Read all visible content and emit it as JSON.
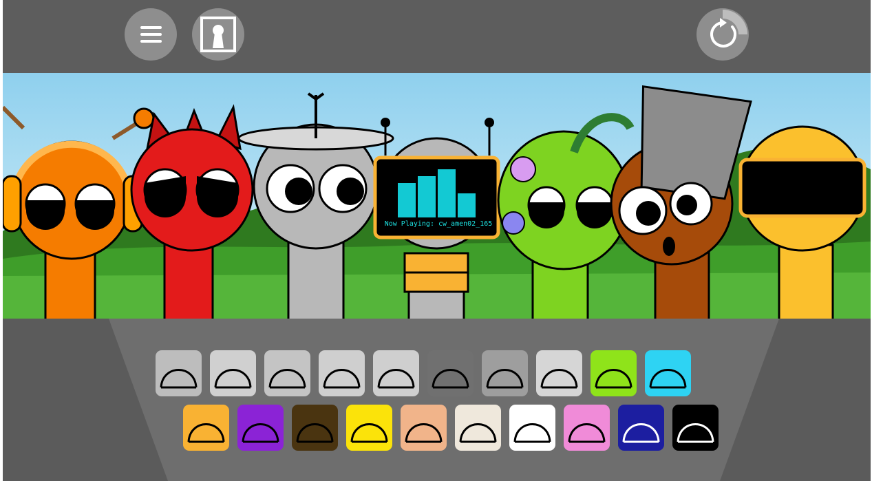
{
  "toolbar": {
    "menu_icon": "hamburger-menu-icon",
    "frame_icon": "keyhole-frame-icon",
    "reset_icon": "refresh-icon"
  },
  "stage": {
    "now_playing": "Now Playing: cw_amen02_165",
    "characters": [
      {
        "name": "orange-headphones",
        "color": "#f57c00"
      },
      {
        "name": "red-horns",
        "color": "#e31b1b"
      },
      {
        "name": "gray-satellite",
        "color": "#b8b8b8"
      },
      {
        "name": "tv-head",
        "color": "#f9b233"
      },
      {
        "name": "green-leaf",
        "color": "#7ed321"
      },
      {
        "name": "brown-bucket",
        "color": "#a64b0a"
      },
      {
        "name": "yellow-visor",
        "color": "#fbc02d"
      }
    ]
  },
  "tray": {
    "row1": [
      {
        "name": "headphones-costume",
        "bg": "#bdbdbd",
        "state": "used"
      },
      {
        "name": "spiky-hair-costume",
        "bg": "#d0d0d0",
        "state": "used"
      },
      {
        "name": "satellite-costume",
        "bg": "#c4c4c4",
        "state": "used"
      },
      {
        "name": "antenna-tv-costume",
        "bg": "#cfcfcf",
        "state": "used"
      },
      {
        "name": "leaf-costume",
        "bg": "#cfcfcf",
        "state": "used"
      },
      {
        "name": "cat-ears-costume",
        "bg": "#707070",
        "state": "used"
      },
      {
        "name": "bucket-costume",
        "bg": "#9e9e9e",
        "state": "used"
      },
      {
        "name": "visor-costume",
        "bg": "#d6d6d6",
        "state": "used"
      },
      {
        "name": "green-spikes-costume",
        "bg": "#8fe31a",
        "state": "available"
      },
      {
        "name": "cyan-earmuffs-costume",
        "bg": "#2ed3f3",
        "state": "available"
      }
    ],
    "row2": [
      {
        "name": "sun-crown-costume",
        "bg": "#f9b233"
      },
      {
        "name": "purple-horns-costume",
        "bg": "#8b23d6"
      },
      {
        "name": "green-blob-costume",
        "bg": "#4a3410"
      },
      {
        "name": "lightning-costume",
        "bg": "#fbe30a"
      },
      {
        "name": "hat-costume",
        "bg": "#f1b48a"
      },
      {
        "name": "propeller-hat-costume",
        "bg": "#efe8dc"
      },
      {
        "name": "white-cat-costume",
        "bg": "#ffffff"
      },
      {
        "name": "bunny-ears-costume",
        "bg": "#f08bd8"
      },
      {
        "name": "blue-dome-costume",
        "bg": "#1c1ea0"
      },
      {
        "name": "black-bench-costume",
        "bg": "#000000"
      }
    ]
  }
}
